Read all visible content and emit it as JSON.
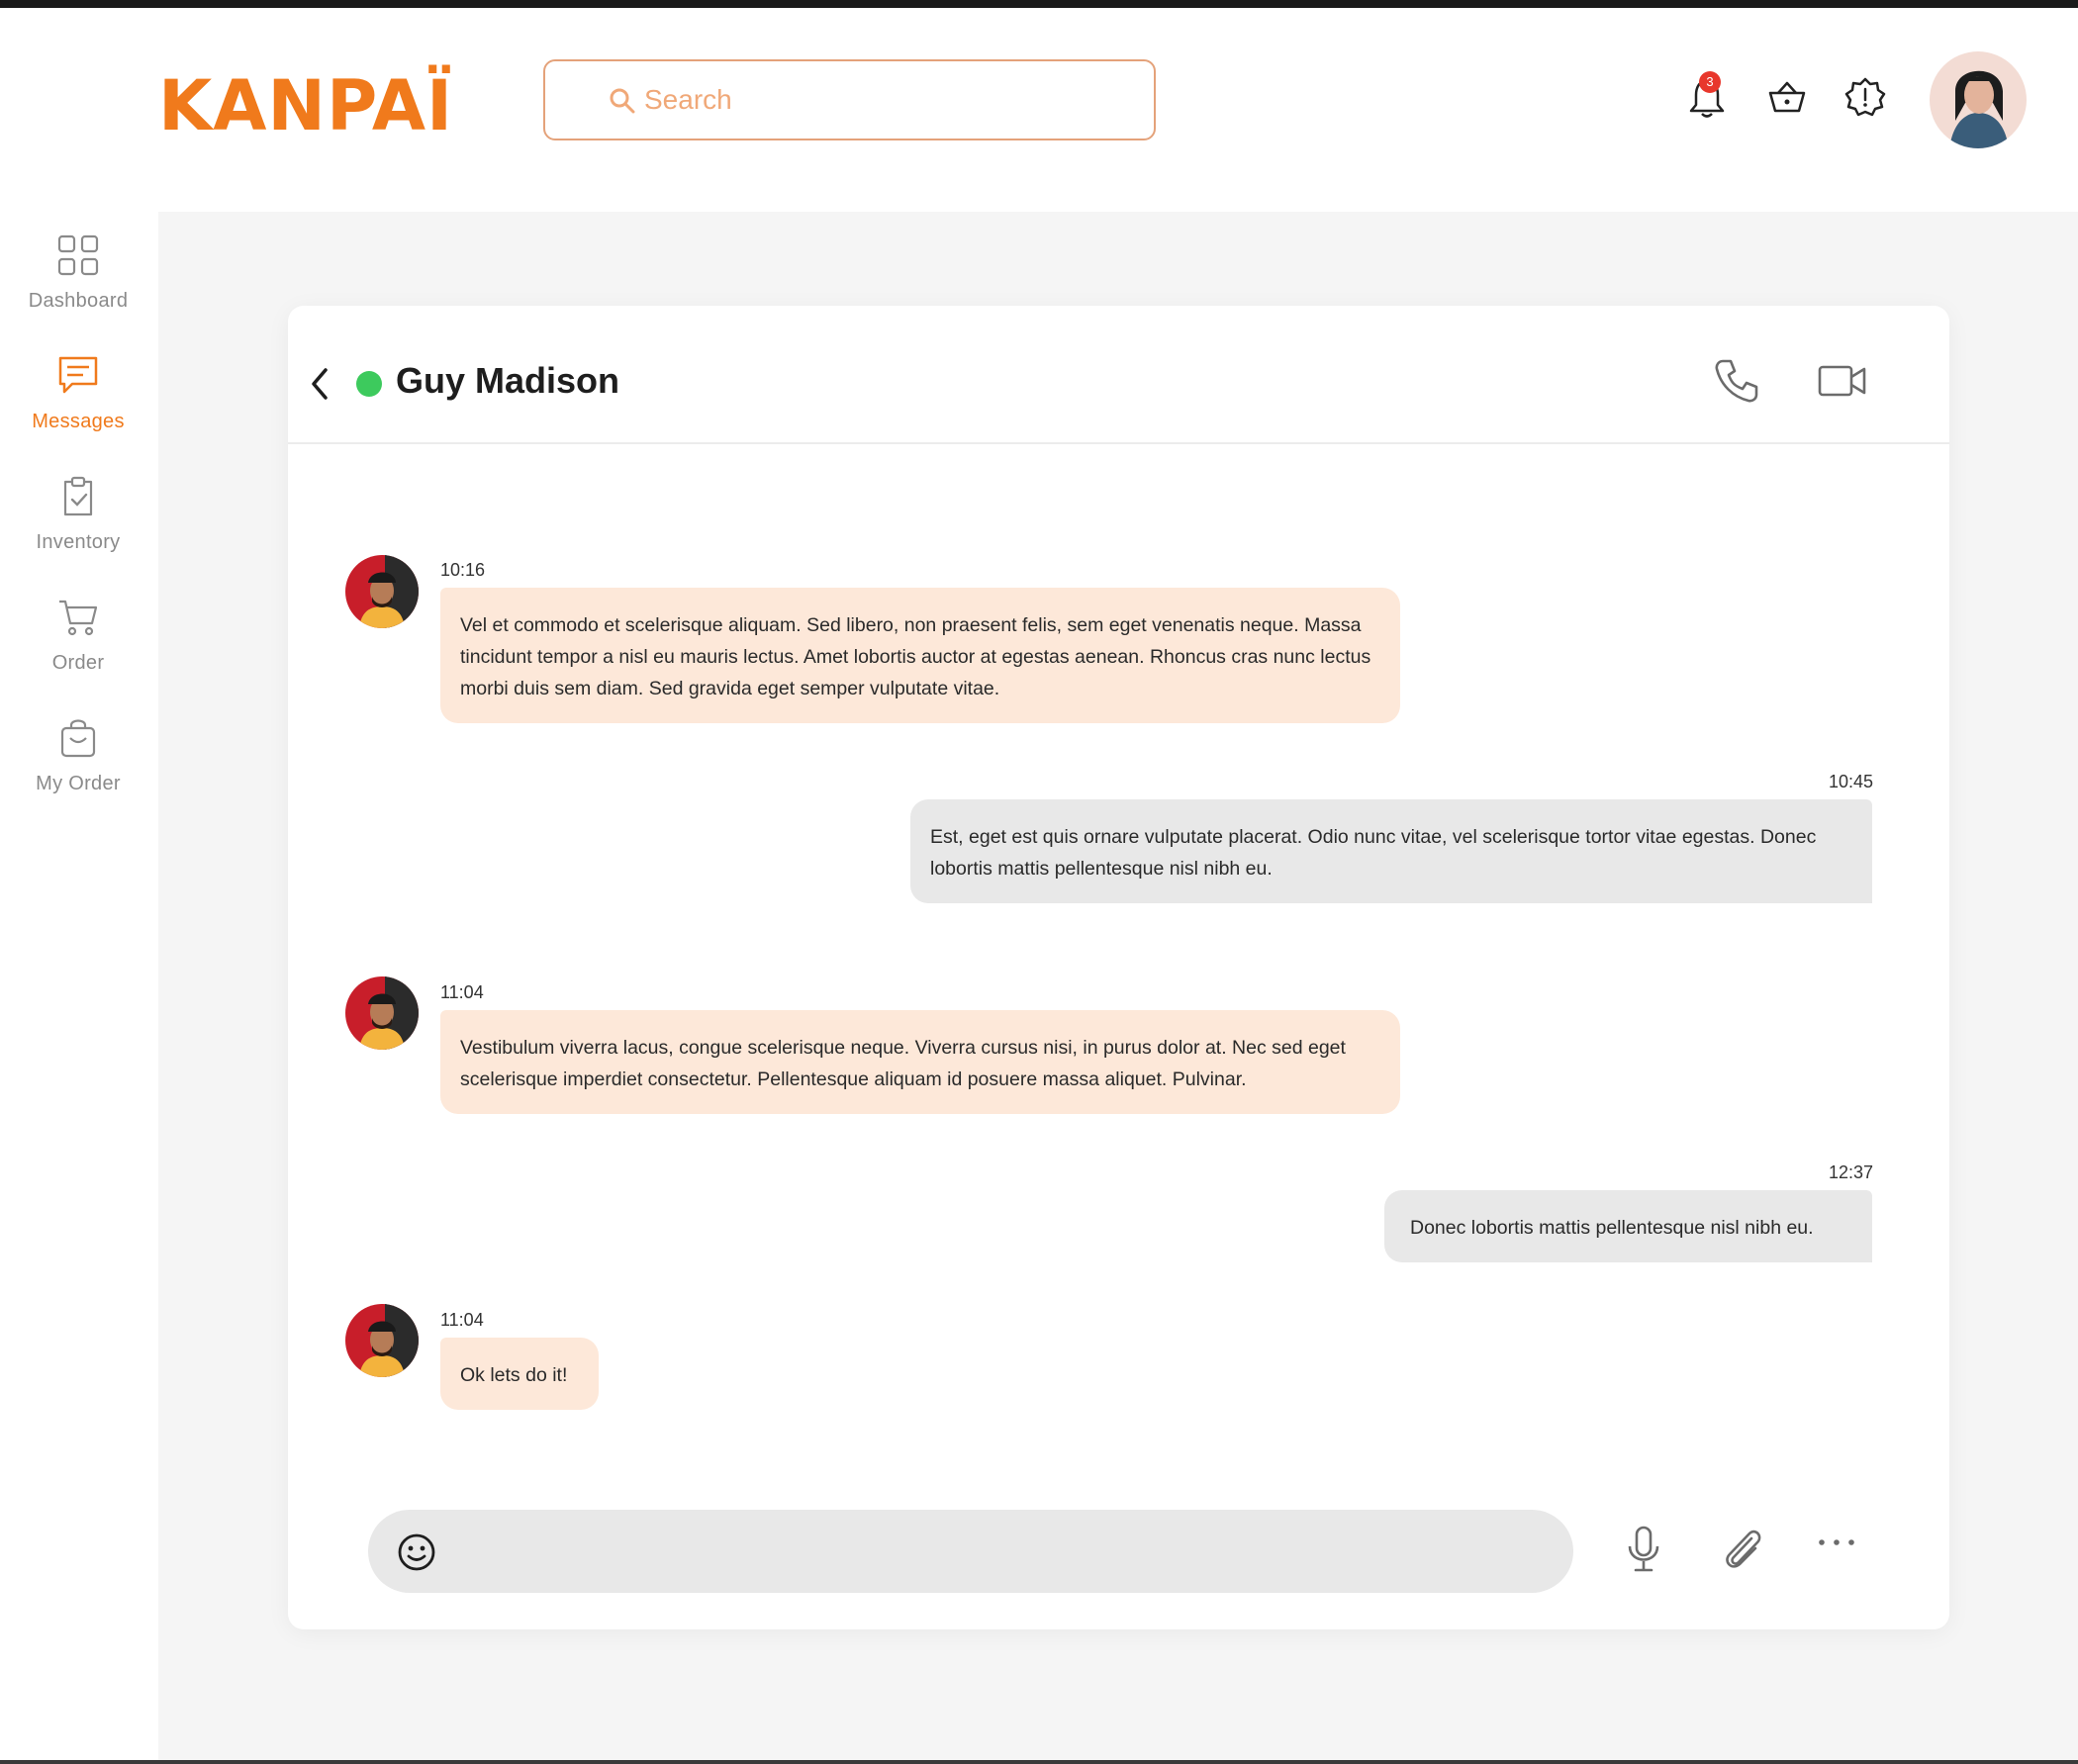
{
  "app": {
    "brand": "KANPAÏ"
  },
  "search": {
    "placeholder": "Search"
  },
  "header": {
    "notification_count": "3",
    "icons": [
      "bell-icon",
      "basket-icon",
      "settings-badge-icon",
      "user-avatar"
    ]
  },
  "sidebar": {
    "items": [
      {
        "label": "Dashboard",
        "icon": "grid-icon",
        "active": false
      },
      {
        "label": "Messages",
        "icon": "chat-icon",
        "active": true
      },
      {
        "label": "Inventory",
        "icon": "clipboard-check-icon",
        "active": false
      },
      {
        "label": "Order",
        "icon": "cart-icon",
        "active": false
      },
      {
        "label": "My Order",
        "icon": "bag-icon",
        "active": false
      }
    ]
  },
  "chat": {
    "contact_name": "Guy Madison",
    "status": "online",
    "messages": [
      {
        "direction": "incoming",
        "time": "10:16",
        "text": "Vel et commodo et scelerisque aliquam. Sed libero, non praesent felis, sem eget venenatis neque. Massa tincidunt tempor a nisl eu mauris lectus. Amet lobortis auctor at egestas aenean. Rhoncus cras nunc lectus morbi duis sem diam. Sed gravida eget semper vulputate vitae."
      },
      {
        "direction": "outgoing",
        "time": "10:45",
        "text": "Est, eget est quis ornare vulputate placerat. Odio nunc vitae, vel scelerisque tortor vitae egestas. Donec lobortis mattis pellentesque nisl nibh eu."
      },
      {
        "direction": "incoming",
        "time": "11:04",
        "text": "Vestibulum viverra lacus, congue scelerisque neque. Viverra cursus nisi, in purus dolor at. Nec sed eget scelerisque imperdiet consectetur. Pellentesque aliquam id posuere massa aliquet. Pulvinar."
      },
      {
        "direction": "outgoing",
        "time": "12:37",
        "text": "Donec lobortis mattis pellentesque nisl nibh eu."
      },
      {
        "direction": "incoming",
        "time": "11:04",
        "text": "Ok lets do it!"
      }
    ]
  },
  "colors": {
    "accent": "#f07a1c",
    "incoming_bubble": "#fde8d9",
    "outgoing_bubble": "#e8e8e8",
    "online": "#3dca5d",
    "badge": "#e8372c"
  }
}
